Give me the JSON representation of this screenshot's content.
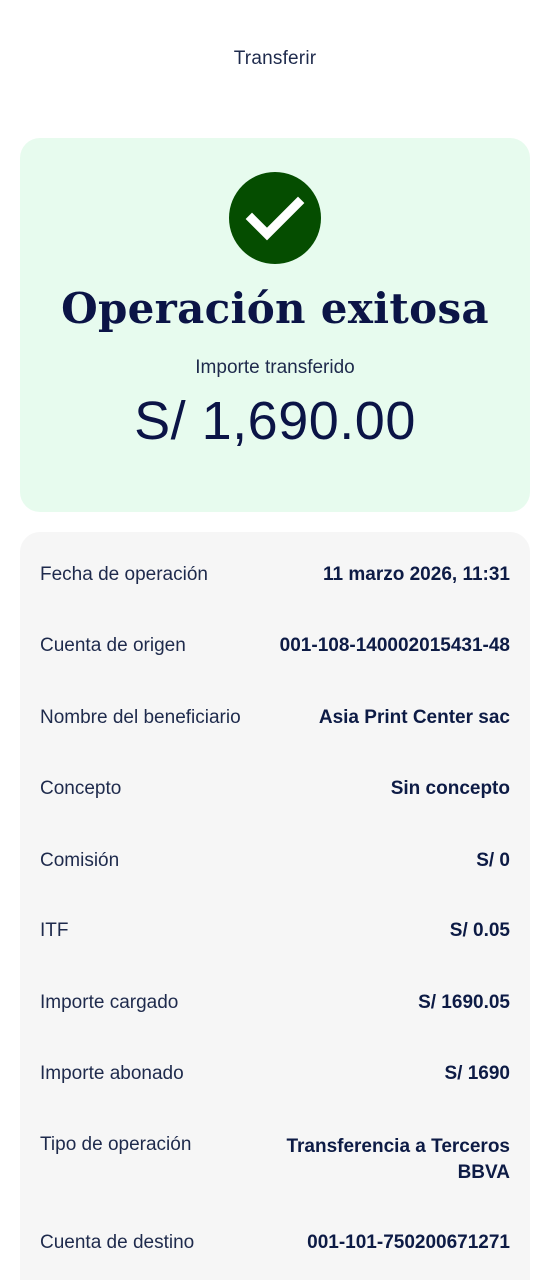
{
  "header": {
    "title": "Transferir"
  },
  "success": {
    "icon": "check-circle-icon",
    "icon_color": "#054d00",
    "card_color": "#e7fbee",
    "title": "Operación exitosa",
    "amount_label": "Importe transferido",
    "amount_value": "S/ 1,690.00"
  },
  "details": [
    {
      "label": "Fecha de operación",
      "value": "11 marzo 2026, 11:31"
    },
    {
      "label": "Cuenta de origen",
      "value": "001-108-140002015431-48"
    },
    {
      "label": "Nombre del beneficiario",
      "value": "Asia Print Center sac"
    },
    {
      "label": "Concepto",
      "value": "Sin concepto"
    },
    {
      "label": "Comisión",
      "value": "S/ 0"
    },
    {
      "label": "ITF",
      "value": "S/ 0.05"
    },
    {
      "label": "Importe cargado",
      "value": "S/ 1690.05"
    },
    {
      "label": "Importe abonado",
      "value": "S/ 1690"
    },
    {
      "label": "Tipo de operación",
      "value": "Transferencia a Terceros BBVA"
    },
    {
      "label": "Cuenta de destino",
      "value": "001-101-750200671271"
    }
  ]
}
